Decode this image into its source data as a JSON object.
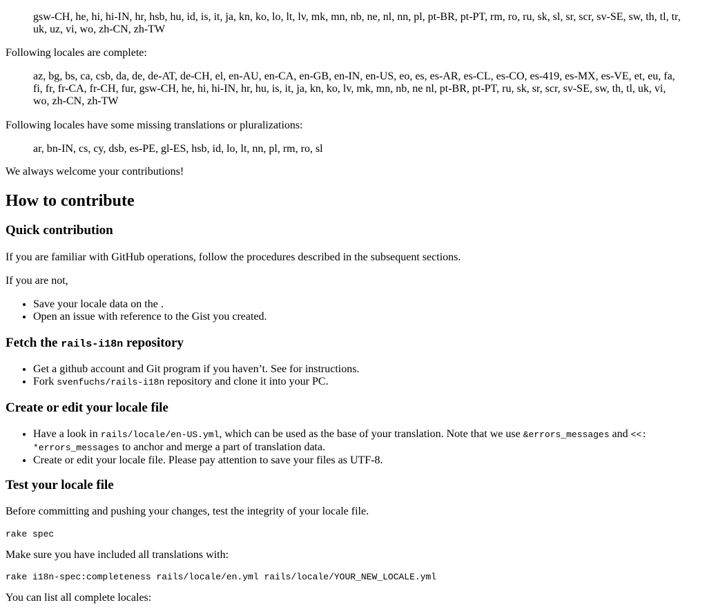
{
  "locales_all_tail": "gsw-CH, he, hi, hi-IN, hr, hsb, hu, id, is, it, ja, kn, ko, lo, lt, lv, mk, mn, nb, ne, nl, nn, pl, pt-BR, pt-PT, rm, ro, ru, sk, sl, sr, scr, sv-SE, sw, th, tl, tr, uk, uz, vi, wo, zh-CN, zh-TW",
  "complete_intro": "Following locales are complete:",
  "complete_list": "az, bg, bs, ca, csb, da, de, de-AT, de-CH, el, en-AU, en-CA, en-GB, en-IN, en-US, eo, es, es-AR, es-CL, es-CO, es-419, es-MX, es-VE, et, eu, fa, fi, fr, fr-CA, fr-CH, fur, gsw-CH, he, hi, hi-IN, hr, hu, is, it, ja, kn, ko, lv, mk, mn, nb, ne nl, pt-BR, pt-PT, ru, sk, sr, scr, sv-SE, sw, th, tl, uk, vi, wo, zh-CN, zh-TW",
  "missing_intro": "Following locales have some missing translations or pluralizations:",
  "missing_list": "ar, bn-IN, cs, cy, dsb, es-PE, gl-ES, hsb, id, lo, lt, nn, pl, rm, ro, sl",
  "welcome": "We always welcome your contributions!",
  "how_to_contribute": "How to contribute",
  "quick": {
    "heading": "Quick contribution",
    "p1": "If you are familiar with GitHub operations, follow the procedures described in the subsequent sections.",
    "p2": "If you are not,",
    "item1": "Save your locale data on the .",
    "item2": "Open an issue with reference to the Gist you created."
  },
  "fetch": {
    "heading_pre": "Fetch the ",
    "heading_code": "rails-i18n",
    "heading_post": " repository",
    "item1": "Get a github account and Git program if you haven’t. See for instructions.",
    "item2_pre": "Fork ",
    "item2_code": "svenfuchs/rails-i18n",
    "item2_post": " repository and clone it into your PC."
  },
  "create": {
    "heading": "Create or edit your locale file",
    "item1_a": "Have a look in ",
    "item1_code1": "rails/locale/en-US.yml",
    "item1_b": ", which can be used as the base of your translation. Note that we use ",
    "item1_code2": "&errors_messages",
    "item1_c": " and ",
    "item1_code3": "<<: *errors_messages",
    "item1_d": " to anchor and merge a part of translation data.",
    "item2": "Create or edit your locale file. Please pay attention to save your files as UTF-8."
  },
  "test": {
    "heading": "Test your locale file",
    "p1": "Before committing and pushing your changes, test the integrity of your locale file.",
    "cmd1": "rake spec",
    "p2": "Make sure you have included all translations with:",
    "cmd2": "rake i18n-spec:completeness rails/locale/en.yml rails/locale/YOUR_NEW_LOCALE.yml",
    "p3": "You can list all complete locales:"
  }
}
